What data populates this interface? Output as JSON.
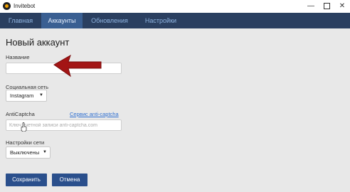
{
  "window": {
    "title": "Invitebot",
    "minimize": "—",
    "maximize": "",
    "close": "✕"
  },
  "nav": {
    "tabs": [
      {
        "label": "Главная"
      },
      {
        "label": "Аккаунты"
      },
      {
        "label": "Обновления"
      },
      {
        "label": "Настройки"
      }
    ],
    "active_index": 1
  },
  "form": {
    "title": "Новый аккаунт",
    "name": {
      "label": "Название",
      "value": "",
      "placeholder": ""
    },
    "network": {
      "label": "Социальная сеть",
      "value": "Instagram"
    },
    "anticaptcha": {
      "label": "AntiCaptcha",
      "link": "Сервис anti-captcha",
      "value": "",
      "placeholder": "Ключ учетной записи anti-captcha.com"
    },
    "network_settings": {
      "label": "Настройки сети",
      "value": "Выключены"
    },
    "save_label": "Сохранить",
    "cancel_label": "Отмена"
  },
  "icons": {
    "app": "invitebot-logo-icon",
    "pointer": "red-arrow-icon",
    "cursor": "mouse-cursor-icon"
  },
  "colors": {
    "navbar": "#2a3f60",
    "active_tab": "#3a5f92",
    "button": "#2a4f8c",
    "link": "#2f6fd0",
    "arrow": "#a31414"
  }
}
